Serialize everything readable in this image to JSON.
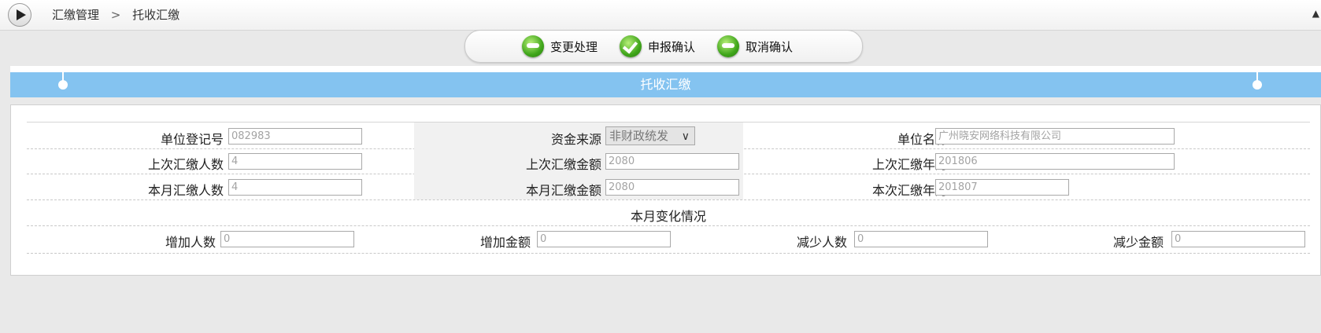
{
  "breadcrumb": {
    "root": "汇缴管理",
    "separator": ">",
    "current": "托收汇缴"
  },
  "scroll_arrow": "▲",
  "toolbar": {
    "change_label": "变更处理",
    "confirm_label": "申报确认",
    "cancel_label": "取消确认"
  },
  "form_title": "托收汇缴",
  "fields": {
    "unit_reg_no": {
      "label": "单位登记号",
      "value": "082983"
    },
    "fund_source": {
      "label": "资金来源",
      "value": "非财政统发"
    },
    "unit_name": {
      "label": "单位名称",
      "value": "广州晓安网络科技有限公司"
    },
    "last_count": {
      "label": "上次汇缴人数",
      "value": "4"
    },
    "last_amount": {
      "label": "上次汇缴金额",
      "value": "2080"
    },
    "last_month": {
      "label": "上次汇缴年月",
      "value": "201806"
    },
    "this_count": {
      "label": "本月汇缴人数",
      "value": "4"
    },
    "this_amount": {
      "label": "本月汇缴金额",
      "value": "2080"
    },
    "this_month": {
      "label": "本次汇缴年月",
      "value": "201807"
    }
  },
  "changes": {
    "title": "本月变化情况",
    "add_count": {
      "label": "增加人数",
      "value": "0"
    },
    "add_amount": {
      "label": "增加金额",
      "value": "0"
    },
    "reduce_count": {
      "label": "减少人数",
      "value": "0"
    },
    "reduce_amount": {
      "label": "减少金额",
      "value": "0"
    }
  },
  "colors": {
    "title_band": "#84c3f0",
    "icon_green": "#3fa51a"
  }
}
